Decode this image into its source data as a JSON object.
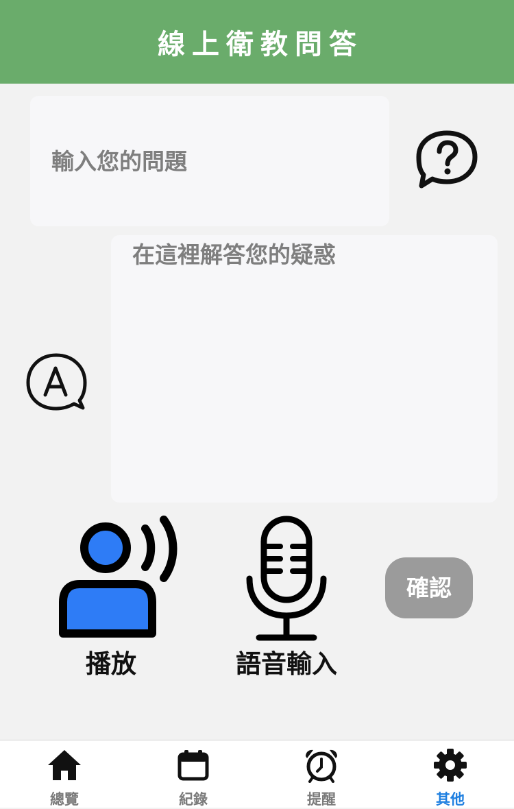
{
  "header": {
    "title": "線上衛教問答"
  },
  "question": {
    "placeholder": "輸入您的問題",
    "value": ""
  },
  "answer": {
    "text": "在這裡解答您的疑惑"
  },
  "actions": {
    "play_label": "播放",
    "voice_input_label": "語音輸入",
    "confirm_label": "確認"
  },
  "bottom_nav": {
    "items": [
      {
        "label": "總覽",
        "icon": "home-icon",
        "active": false
      },
      {
        "label": "紀錄",
        "icon": "calendar-icon",
        "active": false
      },
      {
        "label": "提醒",
        "icon": "alarm-clock-icon",
        "active": false
      },
      {
        "label": "其他",
        "icon": "gear-icon",
        "active": true
      }
    ]
  },
  "colors": {
    "header": "#6aac6b",
    "accent_blue": "#2e7cf6",
    "active_nav": "#1e7fe0",
    "confirm_button": "#9b9b9b",
    "background": "#f2f2f2"
  }
}
